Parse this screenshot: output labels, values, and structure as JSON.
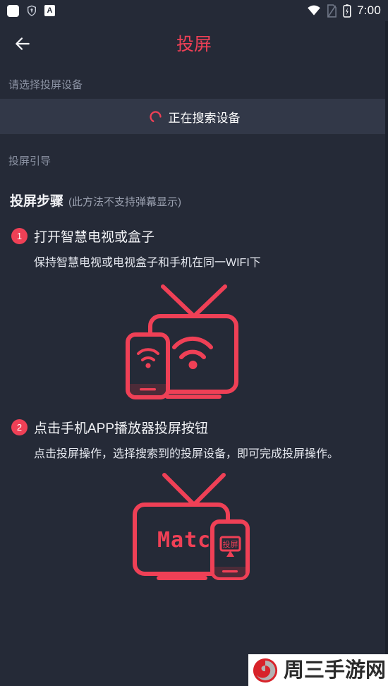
{
  "status_bar": {
    "icons_left": [
      "app-square-icon",
      "shield-icon",
      "letter-a-icon"
    ],
    "icons_right": [
      "wifi-icon",
      "sim-off-icon",
      "battery-charging-icon"
    ],
    "time": "7:00"
  },
  "app_bar": {
    "back_icon": "back-arrow-icon",
    "title": "投屏"
  },
  "device_section": {
    "select_label": "请选择投屏设备",
    "searching_text": "正在搜索设备",
    "spinner_icon": "loading-spinner-icon",
    "guide_label": "投屏引导"
  },
  "steps_section": {
    "heading": "投屏步骤",
    "heading_note": "(此方法不支持弹幕显示)",
    "steps": [
      {
        "number": "1",
        "title": "打开智慧电视或盒子",
        "desc": "保持智慧电视或电视盒子和手机在同一WIFI下",
        "illustration": "tv-phone-wifi-icon"
      },
      {
        "number": "2",
        "title": "点击手机APP播放器投屏按钮",
        "desc": "点击投屏操作，选择搜索到的投屏设备，即可完成投屏操作。",
        "illustration": "tv-match-phone-cast-icon",
        "tv_screen_text": "Match",
        "phone_cast_label": "投屏"
      }
    ]
  },
  "watermark": {
    "text": "周三手游网",
    "logo_icon": "spiral-logo-icon"
  },
  "colors": {
    "background": "#252a37",
    "surface": "#323848",
    "accent": "#ef4056",
    "text_primary": "#f2f3f6",
    "text_secondary": "#8b92a3"
  }
}
